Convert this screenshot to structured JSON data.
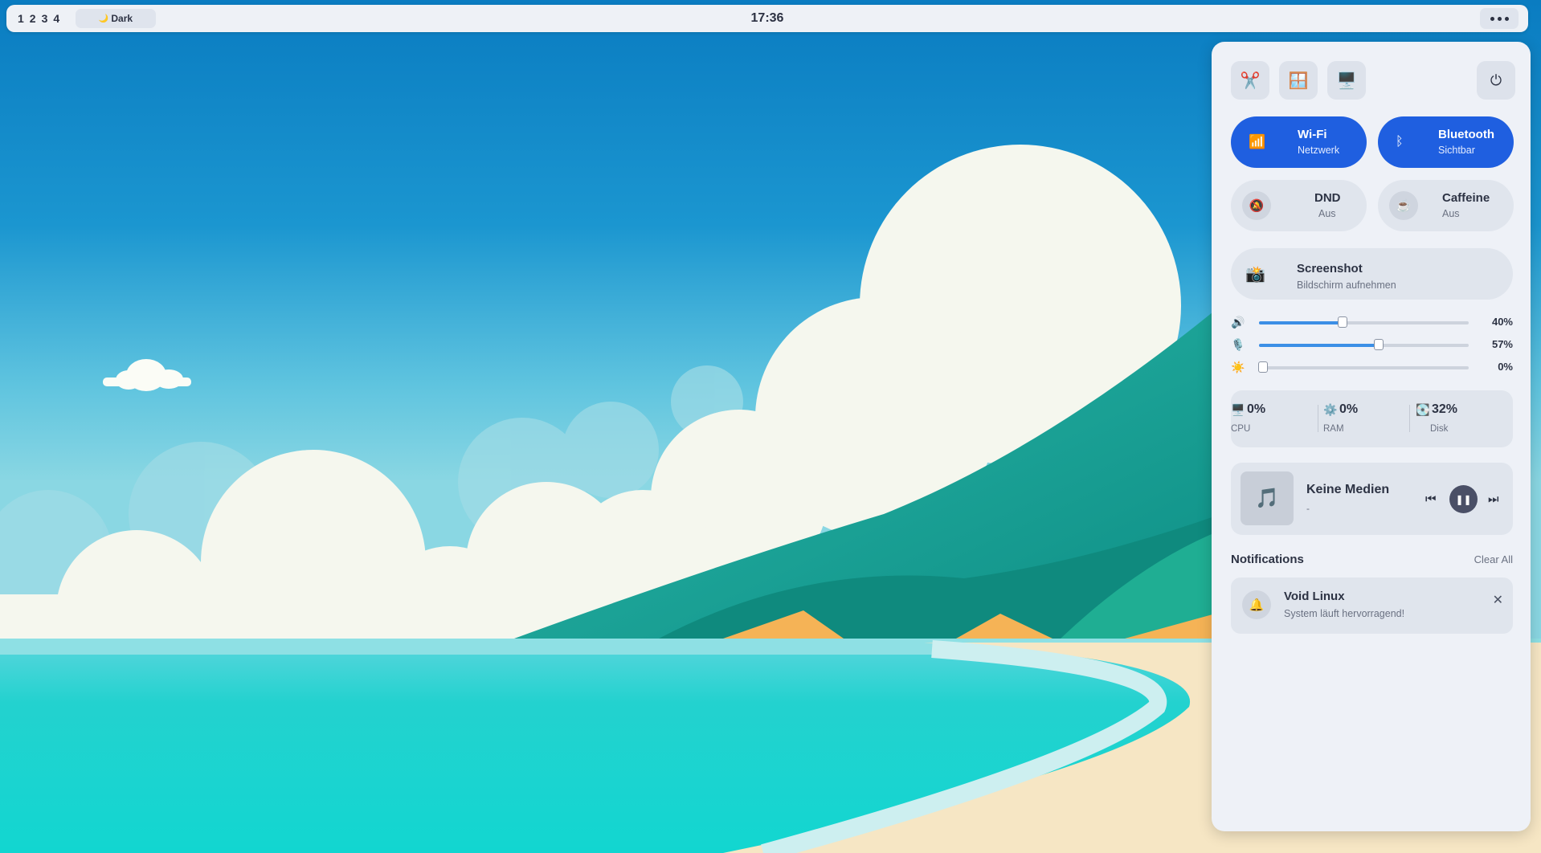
{
  "topbar": {
    "workspaces": [
      "1",
      "2",
      "3",
      "4"
    ],
    "theme_icon": "🌙",
    "theme_label": "Dark",
    "clock": "17:36"
  },
  "panel": {
    "quick_buttons": [
      {
        "name": "scissors-icon",
        "glyph": "✂️"
      },
      {
        "name": "window-icon",
        "glyph": "🪟"
      },
      {
        "name": "monitor-icon",
        "glyph": "🖥️"
      }
    ],
    "power_glyph": "⏻",
    "toggles": {
      "wifi": {
        "icon": "📶",
        "title": "Wi-Fi",
        "sub": "Netzwerk"
      },
      "bluetooth": {
        "icon": "ᛒ",
        "title": "Bluetooth",
        "sub": "Sichtbar"
      },
      "dnd": {
        "icon": "🔕",
        "title": "DND",
        "sub": "Aus"
      },
      "caffeine": {
        "icon": "☕",
        "title": "Caffeine",
        "sub": "Aus"
      }
    },
    "screenshot": {
      "icon": "📸",
      "title": "Screenshot",
      "sub": "Bildschirm aufnehmen"
    },
    "sliders": {
      "volume": {
        "icon": "🔊",
        "value": 40,
        "label": "40%"
      },
      "mic": {
        "icon": "🎙️",
        "value": 57,
        "label": "57%"
      },
      "brightness": {
        "icon": "☀️",
        "value": 0,
        "label": "0%"
      }
    },
    "stats": {
      "cpu": {
        "icon": "🖥️",
        "value": "0%",
        "label": "CPU"
      },
      "ram": {
        "icon": "⚙️",
        "value": "0%",
        "label": "RAM"
      },
      "disk": {
        "icon": "💽",
        "value": "32%",
        "label": "Disk"
      }
    },
    "media": {
      "art_glyph": "🎵",
      "title": "Keine Medien",
      "artist": "-",
      "prev": "⏮",
      "play": "❚❚",
      "next": "⏭"
    },
    "notifications": {
      "header": "Notifications",
      "clear_all": "Clear All",
      "items": [
        {
          "icon": "🔔",
          "title": "Void Linux",
          "body": "System läuft hervorragend!",
          "close": "✕"
        }
      ]
    }
  }
}
